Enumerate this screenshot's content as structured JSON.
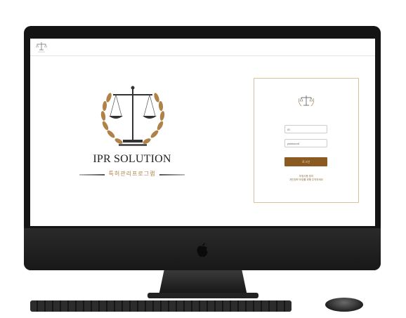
{
  "hero": {
    "title": "IPR SOLUTION",
    "subtitle": "특허관리프로그램",
    "emblem_icon": "scales-of-justice-laurel-icon"
  },
  "topbar": {
    "logo_icon": "scales-of-justice-icon"
  },
  "login": {
    "emblem_icon": "scales-of-justice-icon",
    "id_placeholder": "ID",
    "password_placeholder": "password",
    "login_button": "로그인",
    "note_line1": "부정사용 방지",
    "note_line2": "개인정보 보호를 위해 주의하세요"
  },
  "colors": {
    "accent_gold": "#b08248",
    "button_brown": "#8a5a21",
    "card_border": "#d9c19e"
  },
  "device": {
    "brand_icon": "apple-logo-icon"
  }
}
